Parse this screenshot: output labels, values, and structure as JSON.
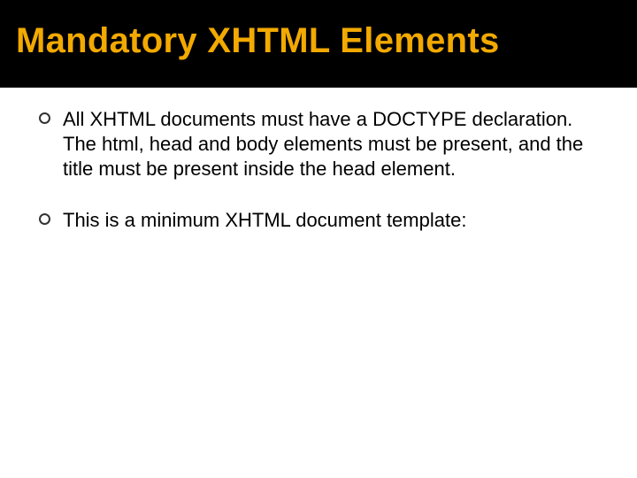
{
  "slide": {
    "title": "Mandatory XHTML Elements",
    "bullets": [
      "All XHTML documents must have a DOCTYPE declaration.  The html, head and body elements must be present, and the title must be present inside the head element.",
      "This is a minimum XHTML document template:"
    ]
  }
}
